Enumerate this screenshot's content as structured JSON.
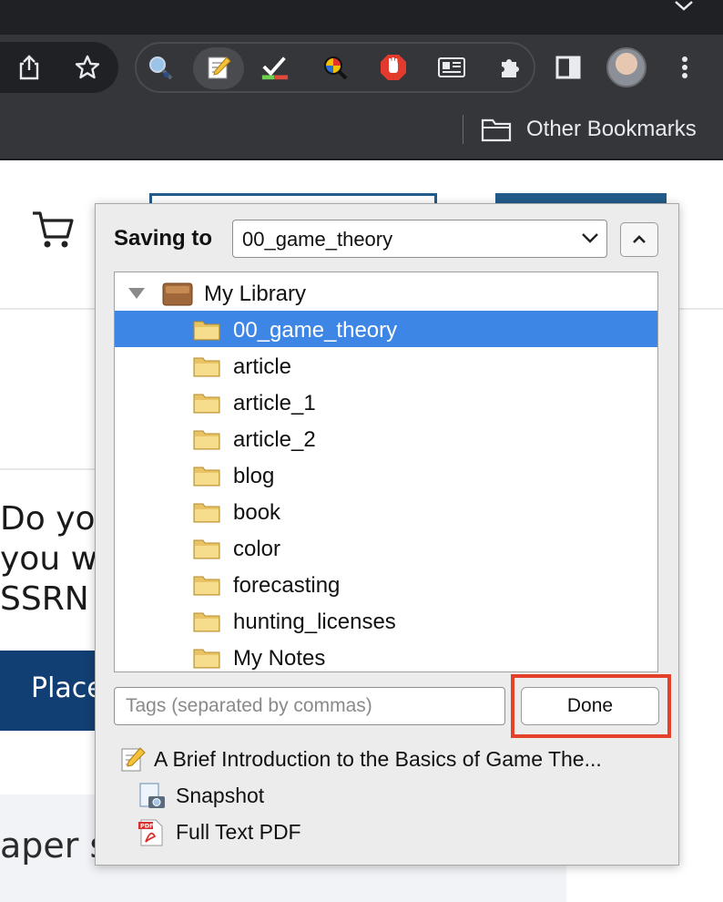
{
  "browser": {
    "bookmarks_bar": {
      "other_bookmarks_label": "Other Bookmarks"
    },
    "toolbar_icons": [
      "share-icon",
      "star-icon",
      "zotero-search-icon",
      "zotero-save-icon",
      "todo-check-icon",
      "color-picker-icon",
      "adblock-hand-icon",
      "reader-view-icon",
      "extensions-puzzle-icon",
      "side-panel-icon",
      "avatar",
      "more-vert-icon"
    ]
  },
  "background_page": {
    "peek_text": "Do yo\nyou w\nSSRN",
    "peek_button": "Place",
    "peek_lower": "aper s"
  },
  "zotero_popup": {
    "saving_to_label": "Saving to",
    "selected_collection": "00_game_theory",
    "tree": {
      "root": "My Library",
      "collections": [
        "00_game_theory",
        "article",
        "article_1",
        "article_2",
        "blog",
        "book",
        "color",
        "forecasting",
        "hunting_licenses",
        "My Notes"
      ],
      "selected_index": 0
    },
    "tags_placeholder": "Tags (separated by commas)",
    "done_label": "Done",
    "items": {
      "main_title": "A Brief Introduction to the Basics of Game The...",
      "attachments": [
        "Snapshot",
        "Full Text PDF"
      ]
    }
  },
  "colors": {
    "selection": "#3d86e6",
    "highlight_box": "#e5412a",
    "chrome_dark": "#35363a"
  }
}
